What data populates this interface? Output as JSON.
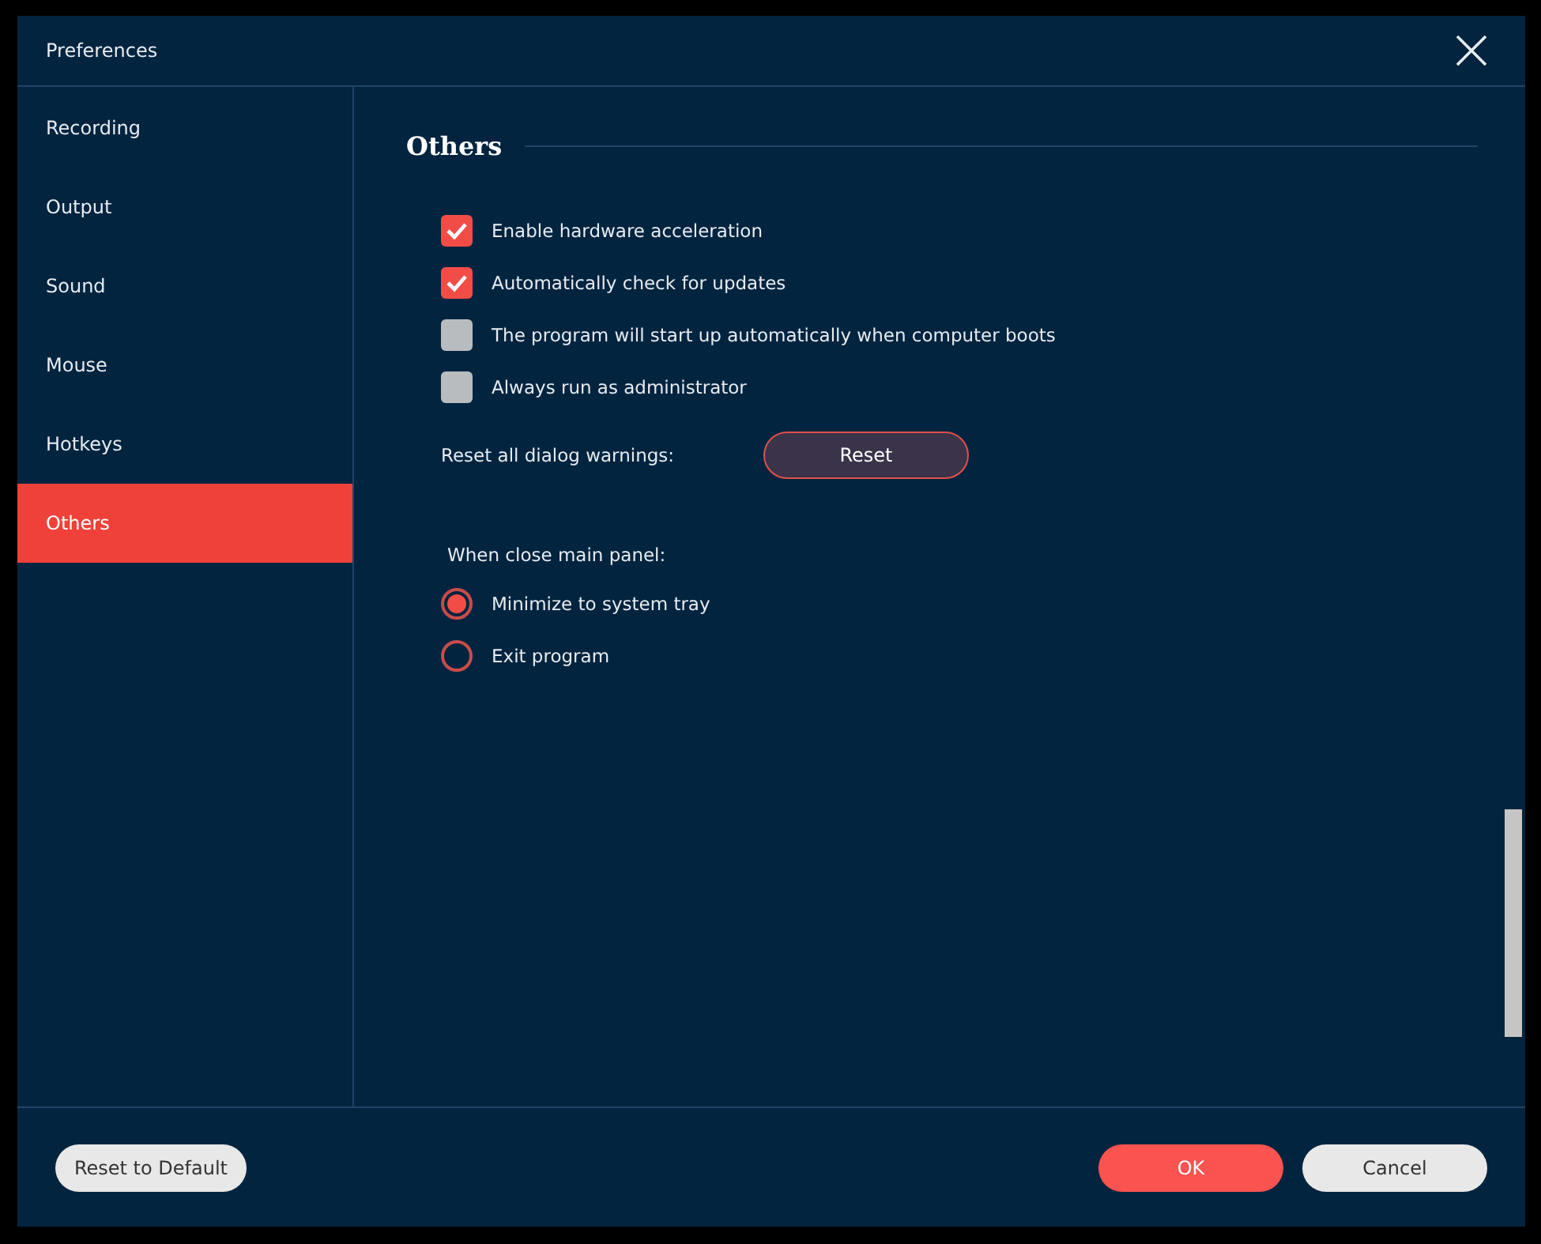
{
  "window": {
    "title": "Preferences"
  },
  "sidebar": {
    "items": [
      {
        "label": "Recording",
        "selected": false
      },
      {
        "label": "Output",
        "selected": false
      },
      {
        "label": "Sound",
        "selected": false
      },
      {
        "label": "Mouse",
        "selected": false
      },
      {
        "label": "Hotkeys",
        "selected": false
      },
      {
        "label": "Others",
        "selected": true
      }
    ]
  },
  "section": {
    "title": "Others",
    "options": [
      {
        "label": "Enable hardware acceleration",
        "checked": true
      },
      {
        "label": "Automatically check for updates",
        "checked": true
      },
      {
        "label": "The program will start up automatically when computer boots",
        "checked": false
      },
      {
        "label": "Always run as administrator",
        "checked": false
      }
    ],
    "reset_warnings": {
      "label": "Reset all dialog warnings:",
      "button": "Reset"
    },
    "close_panel": {
      "label": "When close main panel:",
      "choices": [
        {
          "label": "Minimize to system tray",
          "selected": true
        },
        {
          "label": "Exit program",
          "selected": false
        }
      ]
    }
  },
  "footer": {
    "reset_default": "Reset to Default",
    "ok": "OK",
    "cancel": "Cancel"
  }
}
